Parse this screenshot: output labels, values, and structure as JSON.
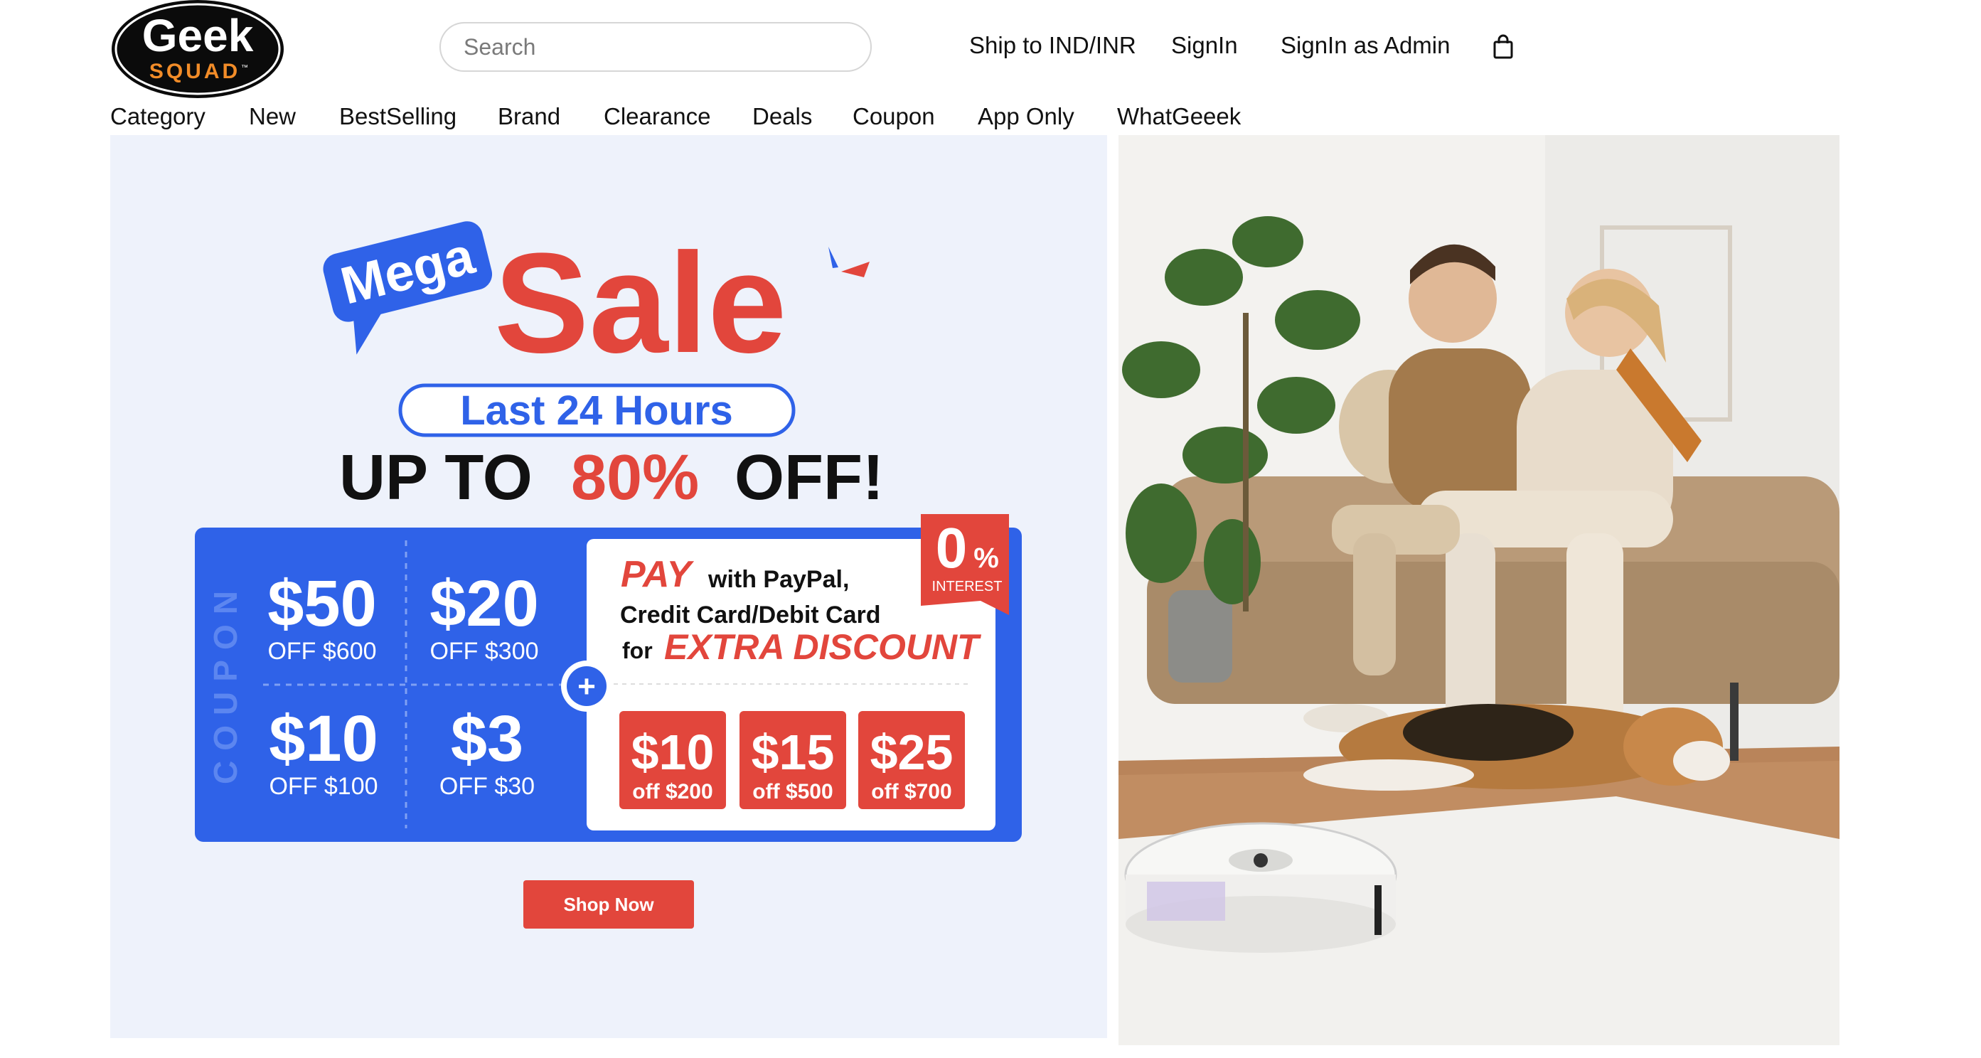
{
  "header": {
    "logo_top": "Geek",
    "logo_bottom": "SQUAD",
    "logo_tm": "™",
    "search_placeholder": "Search",
    "ship_to": "Ship to IND/INR",
    "signin": "SignIn",
    "signin_admin": "SignIn as Admin",
    "cart_icon": "shopping-bag-icon"
  },
  "nav": {
    "items": [
      "Category",
      "New",
      "BestSelling",
      "Brand",
      "Clearance",
      "Deals",
      "Coupon",
      "App Only",
      "WhatGeeek"
    ]
  },
  "banner": {
    "mega": "Mega",
    "sale": "Sale",
    "last_hours": "Last 24 Hours",
    "up_to": "UP TO",
    "percent": "80%",
    "off": "OFF!",
    "coupon_vertical": "COUPON",
    "coupons": [
      {
        "amount": "$50",
        "condition": "OFF $600"
      },
      {
        "amount": "$20",
        "condition": "OFF $300"
      },
      {
        "amount": "$10",
        "condition": "OFF $100"
      },
      {
        "amount": "$3",
        "condition": "OFF $30"
      }
    ],
    "pay_word": "PAY",
    "pay_rest": "with PayPal,",
    "pay_line2": "Credit Card/Debit Card",
    "pay_for": "for",
    "extra_discount": "EXTRA DISCOUNT",
    "zero": "0",
    "zero_pct": "%",
    "interest": "INTEREST",
    "extra_coupons": [
      {
        "amount": "$10",
        "condition": "off $200"
      },
      {
        "amount": "$15",
        "condition": "off $500"
      },
      {
        "amount": "$25",
        "condition": "off $700"
      }
    ],
    "plus": "+",
    "shop_now": "Shop Now"
  },
  "colors": {
    "brand_red": "#e2463c",
    "brand_blue": "#2f62e8",
    "banner_bg": "#eef2fb",
    "logo_orange": "#f28c28"
  }
}
